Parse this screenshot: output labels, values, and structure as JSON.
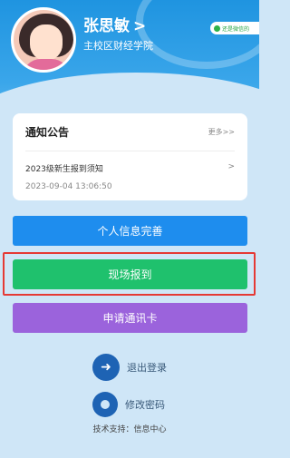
{
  "user": {
    "name": "张思敏",
    "chevron": ">",
    "org": "主校区财经学院"
  },
  "wechat_badge": {
    "label": "还是微信的"
  },
  "notice": {
    "title": "通知公告",
    "more": "更多>>",
    "items": [
      {
        "text": "2023级新生报到须知",
        "arrow": ">",
        "date": "2023-09-04 13:06:50"
      }
    ]
  },
  "buttons": {
    "info": "个人信息完善",
    "checkin": "现场报到",
    "card": "申请通讯卡"
  },
  "actions": {
    "logout": "退出登录",
    "password": "修改密码"
  },
  "footer": {
    "support": "技术支持：信息中心"
  },
  "colors": {
    "header_blue": "#1f94e0",
    "info_button": "#1e8dee",
    "checkin_button": "#1fc16d",
    "card_button": "#9b63dc",
    "highlight": "#e53935"
  }
}
